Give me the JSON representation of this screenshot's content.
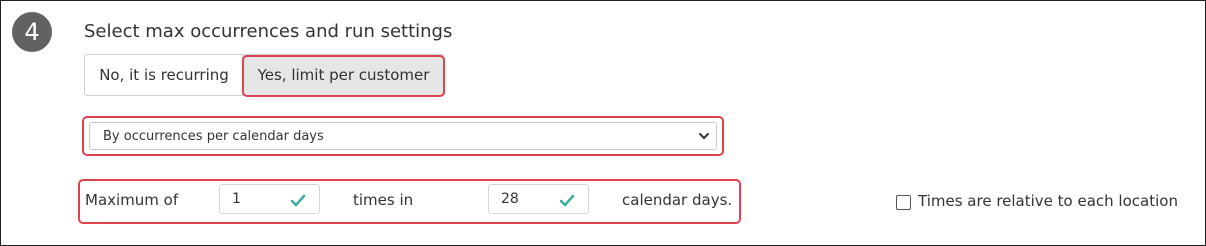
{
  "step": {
    "number": "4"
  },
  "section": {
    "title": "Select max occurrences and run settings"
  },
  "toggle": {
    "options": [
      {
        "label": "No, it is recurring",
        "selected": false
      },
      {
        "label": "Yes, limit per customer",
        "selected": true
      }
    ]
  },
  "limit_type": {
    "selected": "By occurrences per calendar days"
  },
  "limit_row": {
    "prefix": "Maximum of",
    "occurrences_value": "1",
    "middle": "times in",
    "days_value": "28",
    "suffix": "calendar days."
  },
  "relative_option": {
    "label": "Times are relative to each location",
    "checked": false
  },
  "colors": {
    "highlight": "#e0424d",
    "badge": "#616161",
    "valid_check": "#3aaea0",
    "selected_toggle": "#e6e6e6"
  },
  "icons": {
    "select_caret": "chevron-down-icon",
    "input_valid": "checkmark-icon"
  }
}
